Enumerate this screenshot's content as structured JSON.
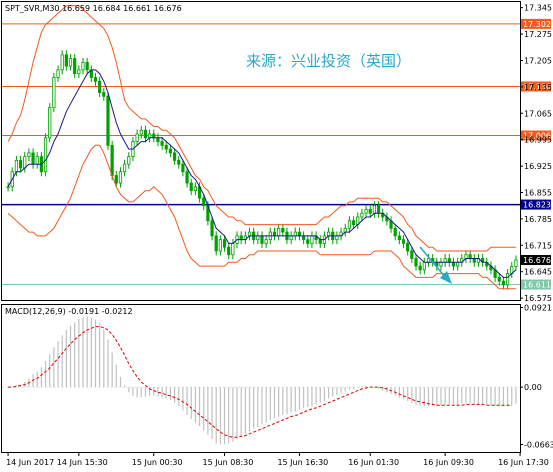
{
  "header": {
    "symbol_info": "SPT_SVR,M30  16.659 16.684 16.661 16.676",
    "macd_info": "MACD(12,26,9) -0.0191 -0.0212"
  },
  "watermark": "来源：兴业投资（英国）",
  "colors": {
    "candle": "#00a000",
    "bollinger": "#f05a1e",
    "ma": "#1a1a8c",
    "resistance": "#f05a1e",
    "pivot_line": "#00008b",
    "support": "#7fc7a8",
    "macd_hist": "#c0c0c0",
    "macd_signal": "#e00000",
    "arrow": "#2aa8c7",
    "label_text": "#ffffff",
    "grid": "#000000"
  },
  "chart_data": [
    {
      "type": "candlestick",
      "ylim": [
        16.57,
        17.36
      ],
      "yticks": [
        "17.345",
        "17.275",
        "17.205",
        "17.135",
        "17.065",
        "16.995",
        "16.925",
        "16.855",
        "16.785",
        "16.715",
        "16.645",
        "16.575"
      ],
      "ytick_values": [
        17.345,
        17.275,
        17.205,
        17.135,
        17.065,
        16.995,
        16.925,
        16.855,
        16.785,
        16.715,
        16.645,
        16.575
      ],
      "x_labels": [
        "14 Jun 2017",
        "14 Jun 15:30",
        "15 Jun 00:30",
        "15 Jun 08:30",
        "15 Jun 16:30",
        "16 Jun 01:30",
        "16 Jun 09:30",
        "16 Jun 17:30"
      ],
      "x_label_index": [
        0,
        17,
        35,
        52,
        70,
        87,
        105,
        123
      ],
      "close": [
        16.87,
        16.91,
        16.94,
        16.92,
        16.95,
        16.96,
        16.93,
        16.95,
        16.91,
        17.0,
        17.08,
        17.16,
        17.18,
        17.22,
        17.19,
        17.21,
        17.17,
        17.18,
        17.2,
        17.18,
        17.16,
        17.15,
        17.12,
        17.11,
        16.98,
        16.9,
        16.88,
        16.91,
        16.93,
        16.95,
        16.99,
        17.01,
        17.02,
        17.0,
        17.01,
        17.0,
        16.99,
        16.98,
        16.97,
        16.96,
        16.94,
        16.93,
        16.91,
        16.88,
        16.86,
        16.87,
        16.84,
        16.82,
        16.78,
        16.74,
        16.7,
        16.73,
        16.71,
        16.69,
        16.72,
        16.74,
        16.73,
        16.74,
        16.75,
        16.73,
        16.74,
        16.72,
        16.73,
        16.75,
        16.74,
        16.76,
        16.75,
        16.73,
        16.74,
        16.75,
        16.74,
        16.73,
        16.72,
        16.74,
        16.73,
        16.72,
        16.74,
        16.75,
        16.73,
        16.74,
        16.75,
        16.76,
        16.78,
        16.77,
        16.79,
        16.8,
        16.81,
        16.8,
        16.82,
        16.8,
        16.79,
        16.78,
        16.76,
        16.74,
        16.73,
        16.72,
        16.7,
        16.68,
        16.66,
        16.65,
        16.67,
        16.68,
        16.67,
        16.66,
        16.67,
        16.68,
        16.67,
        16.66,
        16.67,
        16.68,
        16.69,
        16.68,
        16.67,
        16.68,
        16.67,
        16.66,
        16.65,
        16.63,
        16.62,
        16.61,
        16.64,
        16.659,
        16.676
      ],
      "series": [
        {
          "name": "MA",
          "values": [
            16.87,
            16.89,
            16.91,
            16.91,
            16.92,
            16.93,
            16.93,
            16.93,
            16.93,
            16.94,
            16.96,
            16.99,
            17.01,
            17.04,
            17.07,
            17.09,
            17.11,
            17.13,
            17.15,
            17.17,
            17.18,
            17.18,
            17.17,
            17.15,
            17.12,
            17.08,
            17.04,
            17.01,
            16.99,
            16.97,
            16.97,
            16.98,
            16.99,
            16.99,
            17.0,
            17.0,
            17.0,
            17.0,
            16.99,
            16.98,
            16.97,
            16.96,
            16.94,
            16.92,
            16.9,
            16.89,
            16.87,
            16.85,
            16.82,
            16.79,
            16.76,
            16.75,
            16.74,
            16.72,
            16.72,
            16.73,
            16.73,
            16.73,
            16.74,
            16.74,
            16.74,
            16.74,
            16.74,
            16.74,
            16.74,
            16.74,
            16.74,
            16.74,
            16.74,
            16.74,
            16.74,
            16.74,
            16.74,
            16.74,
            16.74,
            16.73,
            16.73,
            16.74,
            16.74,
            16.74,
            16.74,
            16.75,
            16.75,
            16.76,
            16.77,
            16.78,
            16.79,
            16.79,
            16.8,
            16.8,
            16.8,
            16.79,
            16.78,
            16.77,
            16.76,
            16.75,
            16.73,
            16.71,
            16.69,
            16.68,
            16.67,
            16.67,
            16.67,
            16.67,
            16.67,
            16.67,
            16.67,
            16.67,
            16.67,
            16.67,
            16.68,
            16.68,
            16.68,
            16.68,
            16.67,
            16.67,
            16.66,
            16.65,
            16.64,
            16.63,
            16.63,
            16.64,
            16.65
          ]
        },
        {
          "name": "BB Upper",
          "values": [
            16.99,
            17.01,
            17.04,
            17.06,
            17.1,
            17.15,
            17.2,
            17.24,
            17.28,
            17.3,
            17.31,
            17.32,
            17.33,
            17.34,
            17.35,
            17.35,
            17.35,
            17.35,
            17.34,
            17.33,
            17.32,
            17.31,
            17.3,
            17.29,
            17.27,
            17.24,
            17.2,
            17.15,
            17.1,
            17.08,
            17.07,
            17.06,
            17.05,
            17.05,
            17.04,
            17.03,
            17.03,
            17.02,
            17.02,
            17.01,
            17.0,
            16.98,
            16.96,
            16.94,
            16.92,
            16.9,
            16.89,
            16.87,
            16.86,
            16.84,
            16.82,
            16.81,
            16.8,
            16.79,
            16.79,
            16.78,
            16.78,
            16.77,
            16.77,
            16.77,
            16.77,
            16.77,
            16.77,
            16.77,
            16.77,
            16.77,
            16.77,
            16.77,
            16.77,
            16.77,
            16.77,
            16.77,
            16.77,
            16.77,
            16.77,
            16.78,
            16.79,
            16.79,
            16.8,
            16.81,
            16.82,
            16.82,
            16.83,
            16.83,
            16.84,
            16.84,
            16.84,
            16.84,
            16.84,
            16.84,
            16.83,
            16.83,
            16.82,
            16.81,
            16.8,
            16.79,
            16.77,
            16.76,
            16.74,
            16.73,
            16.72,
            16.71,
            16.71,
            16.7,
            16.7,
            16.7,
            16.7,
            16.7,
            16.7,
            16.7,
            16.7,
            16.7,
            16.7,
            16.7,
            16.7,
            16.7,
            16.71,
            16.71,
            16.71,
            16.71,
            16.71,
            16.71,
            16.71
          ]
        },
        {
          "name": "BB Lower",
          "values": [
            16.8,
            16.79,
            16.78,
            16.77,
            16.76,
            16.75,
            16.75,
            16.74,
            16.74,
            16.74,
            16.75,
            16.76,
            16.78,
            16.8,
            16.82,
            16.84,
            16.87,
            16.9,
            16.93,
            16.95,
            16.97,
            16.98,
            16.98,
            16.96,
            16.93,
            16.9,
            16.87,
            16.85,
            16.84,
            16.83,
            16.83,
            16.84,
            16.85,
            16.86,
            16.86,
            16.87,
            16.86,
            16.85,
            16.83,
            16.81,
            16.79,
            16.76,
            16.73,
            16.7,
            16.68,
            16.67,
            16.66,
            16.66,
            16.66,
            16.66,
            16.66,
            16.66,
            16.66,
            16.67,
            16.67,
            16.67,
            16.68,
            16.68,
            16.69,
            16.69,
            16.7,
            16.7,
            16.7,
            16.7,
            16.7,
            16.7,
            16.7,
            16.7,
            16.7,
            16.7,
            16.7,
            16.7,
            16.7,
            16.7,
            16.7,
            16.69,
            16.69,
            16.69,
            16.69,
            16.69,
            16.69,
            16.69,
            16.69,
            16.69,
            16.69,
            16.69,
            16.69,
            16.69,
            16.7,
            16.7,
            16.7,
            16.7,
            16.7,
            16.69,
            16.68,
            16.66,
            16.65,
            16.64,
            16.63,
            16.63,
            16.63,
            16.63,
            16.63,
            16.64,
            16.64,
            16.64,
            16.64,
            16.64,
            16.64,
            16.64,
            16.64,
            16.64,
            16.64,
            16.64,
            16.63,
            16.63,
            16.62,
            16.61,
            16.6,
            16.6,
            16.6,
            16.6,
            16.6
          ]
        }
      ],
      "levels": [
        {
          "name": "resistance-1",
          "value": 17.302,
          "label": "17.302",
          "color": "#f05a1e"
        },
        {
          "name": "resistance-2",
          "value": 17.136,
          "label": "17.136",
          "color": "#f05a1e"
        },
        {
          "name": "resistance-3",
          "value": 17.006,
          "label": "17.006",
          "color": "#f05a1e"
        },
        {
          "name": "pivot",
          "value": 16.823,
          "label": "16.823",
          "color": "#00008b"
        },
        {
          "name": "support-1",
          "value": 16.611,
          "label": "16.611",
          "color": "#7fc7a8"
        }
      ],
      "current_price": {
        "value": 16.676,
        "label": "16.676"
      }
    },
    {
      "type": "bar",
      "name": "MACD(12,26,9)",
      "ylim": [
        -0.075,
        0.095
      ],
      "yticks": [
        "0.0921",
        "0.00",
        "-0.0663"
      ],
      "ytick_values": [
        0.0921,
        0.0,
        -0.0663
      ],
      "histogram": [
        -0.001,
        0.0,
        0.002,
        0.003,
        0.006,
        0.01,
        0.015,
        0.018,
        0.023,
        0.03,
        0.038,
        0.046,
        0.053,
        0.06,
        0.066,
        0.071,
        0.075,
        0.079,
        0.081,
        0.082,
        0.08,
        0.078,
        0.074,
        0.067,
        0.055,
        0.04,
        0.026,
        0.012,
        0.002,
        -0.006,
        -0.01,
        -0.012,
        -0.012,
        -0.011,
        -0.01,
        -0.01,
        -0.011,
        -0.012,
        -0.013,
        -0.015,
        -0.018,
        -0.022,
        -0.027,
        -0.032,
        -0.037,
        -0.041,
        -0.045,
        -0.05,
        -0.055,
        -0.06,
        -0.065,
        -0.066,
        -0.066,
        -0.065,
        -0.063,
        -0.06,
        -0.057,
        -0.054,
        -0.051,
        -0.048,
        -0.046,
        -0.043,
        -0.041,
        -0.038,
        -0.036,
        -0.034,
        -0.032,
        -0.031,
        -0.029,
        -0.028,
        -0.026,
        -0.024,
        -0.023,
        -0.022,
        -0.02,
        -0.018,
        -0.016,
        -0.013,
        -0.011,
        -0.009,
        -0.007,
        -0.005,
        -0.003,
        -0.002,
        0.0,
        0.001,
        0.002,
        0.001,
        0.0,
        -0.002,
        -0.004,
        -0.006,
        -0.008,
        -0.01,
        -0.012,
        -0.014,
        -0.016,
        -0.018,
        -0.02,
        -0.021,
        -0.022,
        -0.022,
        -0.022,
        -0.022,
        -0.021,
        -0.021,
        -0.02,
        -0.02,
        -0.02,
        -0.019,
        -0.019,
        -0.019,
        -0.019,
        -0.02,
        -0.02,
        -0.02,
        -0.021,
        -0.021,
        -0.022,
        -0.022,
        -0.021,
        -0.021,
        -0.0191
      ],
      "signal": [
        0.0,
        0.0,
        0.001,
        0.002,
        0.003,
        0.005,
        0.008,
        0.01,
        0.014,
        0.018,
        0.022,
        0.028,
        0.033,
        0.039,
        0.045,
        0.05,
        0.055,
        0.059,
        0.063,
        0.066,
        0.068,
        0.07,
        0.07,
        0.069,
        0.066,
        0.061,
        0.054,
        0.046,
        0.037,
        0.027,
        0.019,
        0.012,
        0.006,
        0.002,
        -0.002,
        -0.004,
        -0.006,
        -0.007,
        -0.009,
        -0.01,
        -0.012,
        -0.014,
        -0.017,
        -0.02,
        -0.024,
        -0.028,
        -0.032,
        -0.036,
        -0.04,
        -0.044,
        -0.048,
        -0.052,
        -0.055,
        -0.057,
        -0.058,
        -0.058,
        -0.057,
        -0.056,
        -0.054,
        -0.052,
        -0.05,
        -0.048,
        -0.046,
        -0.044,
        -0.042,
        -0.04,
        -0.038,
        -0.036,
        -0.034,
        -0.033,
        -0.031,
        -0.029,
        -0.027,
        -0.025,
        -0.024,
        -0.022,
        -0.02,
        -0.018,
        -0.016,
        -0.014,
        -0.012,
        -0.01,
        -0.008,
        -0.006,
        -0.004,
        -0.002,
        -0.001,
        0.0,
        0.0,
        0.0,
        -0.001,
        -0.002,
        -0.004,
        -0.006,
        -0.008,
        -0.01,
        -0.012,
        -0.014,
        -0.016,
        -0.017,
        -0.018,
        -0.019,
        -0.02,
        -0.021,
        -0.021,
        -0.021,
        -0.021,
        -0.021,
        -0.021,
        -0.021,
        -0.02,
        -0.02,
        -0.02,
        -0.02,
        -0.02,
        -0.021,
        -0.021,
        -0.021,
        -0.021,
        -0.021,
        -0.021,
        -0.0212
      ]
    }
  ]
}
